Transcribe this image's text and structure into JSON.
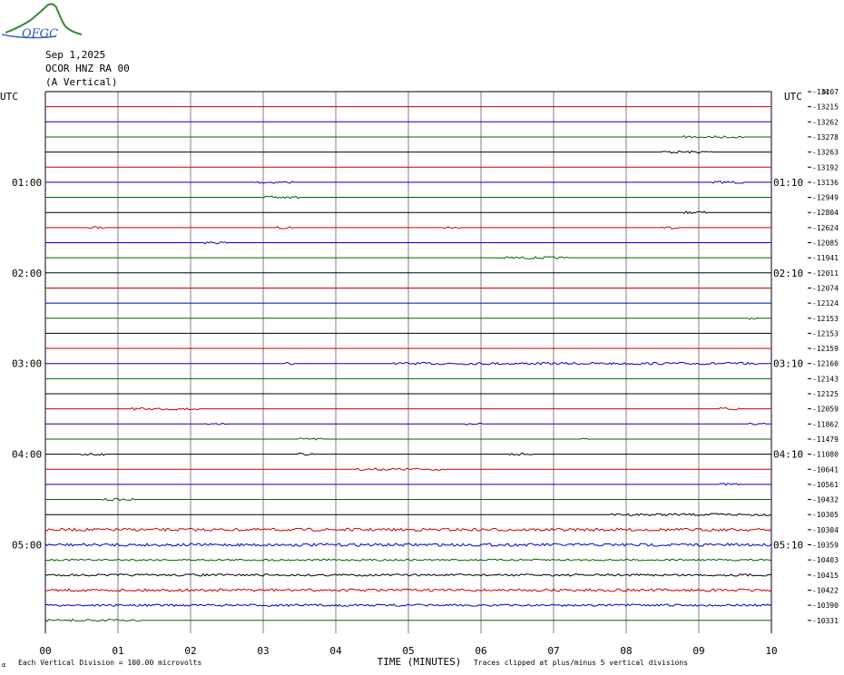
{
  "header": {
    "date": "Sep 1,2025",
    "station": "OCOR HNZ RA 00",
    "component": "(A Vertical)",
    "logo_text": "OFGC"
  },
  "axis_labels": {
    "utc_left": "UTC",
    "utc_right": "UTC",
    "dc_label": "DC",
    "xlabel": "TIME (MINUTES)",
    "note_left": "Each Vertical Division =  100.00 microvolts",
    "note_right": "Traces clipped at plus/minus 5 vertical divisions",
    "corner_mark": "α"
  },
  "colors": {
    "black": "#000000",
    "red": "#cc0000",
    "blue": "#0000cc",
    "green": "#006600",
    "grid": "#808080"
  },
  "chart_data": {
    "type": "line",
    "title": "",
    "xlabel": "TIME (MINUTES)",
    "x_ticks": [
      "00",
      "01",
      "02",
      "03",
      "04",
      "05",
      "06",
      "07",
      "08",
      "09",
      "10"
    ],
    "xlim": [
      0,
      10
    ],
    "left_time_labels": [
      {
        "row": 6,
        "label": "01:00"
      },
      {
        "row": 12,
        "label": "02:00"
      },
      {
        "row": 18,
        "label": "03:00"
      },
      {
        "row": 24,
        "label": "04:00"
      },
      {
        "row": 30,
        "label": "05:00"
      }
    ],
    "right_time_labels": [
      {
        "row": 6,
        "label": "01:10"
      },
      {
        "row": 12,
        "label": "02:10"
      },
      {
        "row": 18,
        "label": "03:10"
      },
      {
        "row": 24,
        "label": "04:10"
      },
      {
        "row": 30,
        "label": "05:10"
      }
    ],
    "trace_colors_cycle": [
      "black",
      "red",
      "blue",
      "green"
    ],
    "dc_offsets": [
      "-13107",
      "-13215",
      "-13262",
      "-13278",
      "-13263",
      "-13192",
      "-13136",
      "-12949",
      "-12804",
      "-12624",
      "-12085",
      "-11941",
      "-12011",
      "-12074",
      "-12124",
      "-12153",
      "-12153",
      "-12159",
      "-12160",
      "-12143",
      "-12125",
      "-12059",
      "-11862",
      "-11479",
      "-11080",
      "-10641",
      "-10561",
      "-10432",
      "-10305",
      "-10304",
      "-10359",
      "-10403",
      "-10415",
      "-10422",
      "-10390",
      "-10331"
    ],
    "rows": 36
  }
}
